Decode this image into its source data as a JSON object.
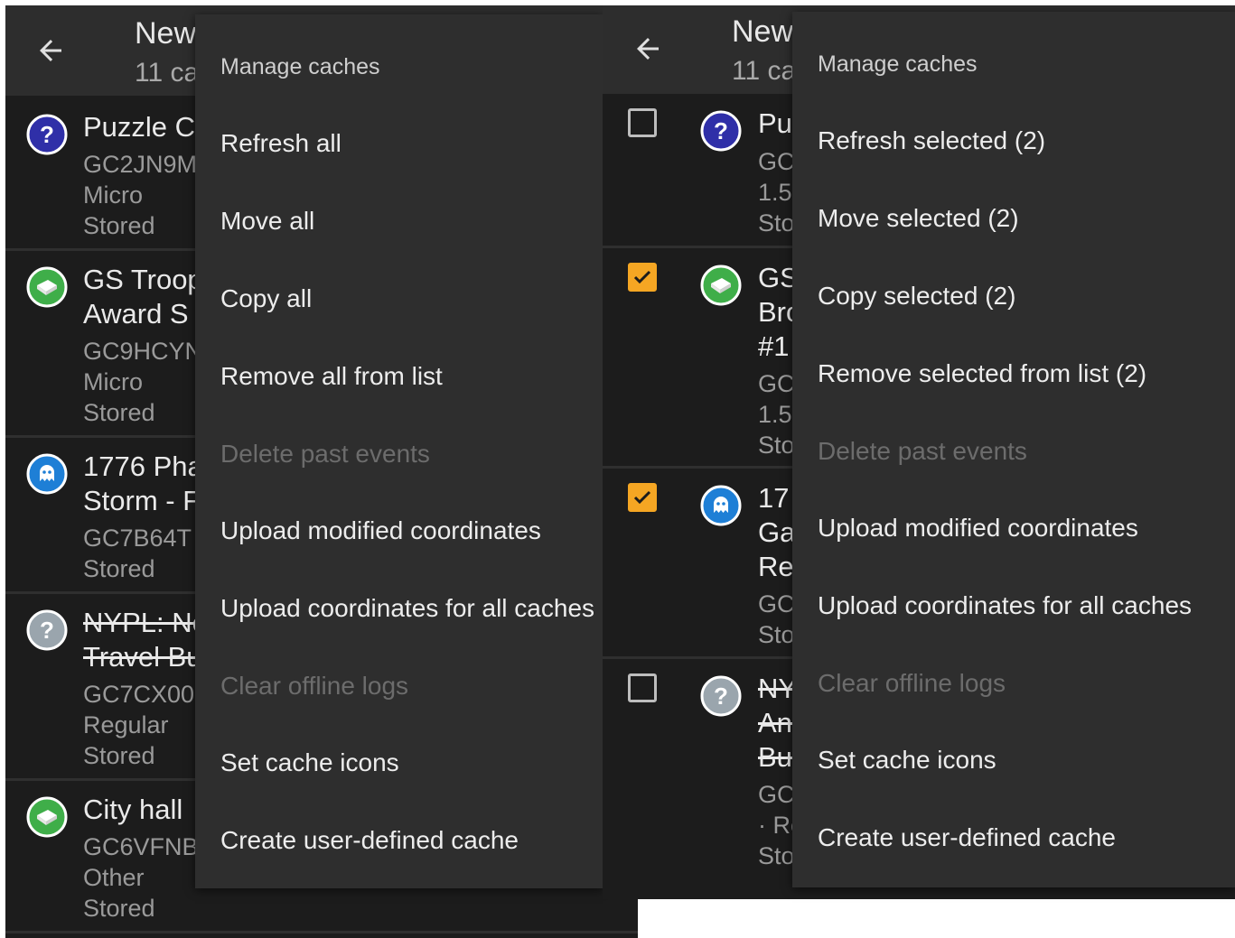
{
  "left": {
    "toolbar": {
      "title": "New",
      "subtitle": "11 ca"
    },
    "rows": [
      {
        "name1": "Puzzle C",
        "code": "GC2JN9M",
        "size": "Micro",
        "status": "Stored"
      },
      {
        "name1": "GS Troop",
        "name2": "Award S",
        "code": "GC9HCYN",
        "size": "Micro",
        "status": "Stored"
      },
      {
        "name1": "1776 Pha",
        "name2": "Storm - F",
        "code": "GC7B64T",
        "status": "Stored"
      },
      {
        "name1": "NYPL: Ne",
        "name2": "Travel Bu",
        "code": "GC7CX00",
        "size": "Regular",
        "status": "Stored"
      },
      {
        "name1": "City hall",
        "code": "GC6VFNB",
        "size": "Other",
        "status": "Stored"
      }
    ],
    "menu": {
      "header": "Manage caches",
      "items": [
        {
          "label": "Refresh all",
          "enabled": true
        },
        {
          "label": "Move all",
          "enabled": true
        },
        {
          "label": "Copy all",
          "enabled": true
        },
        {
          "label": "Remove all from list",
          "enabled": true
        },
        {
          "label": "Delete past events",
          "enabled": false
        },
        {
          "label": "Upload modified coordinates",
          "enabled": true
        },
        {
          "label": "Upload coordinates for all caches",
          "enabled": true
        },
        {
          "label": "Clear offline logs",
          "enabled": false
        },
        {
          "label": "Set cache icons",
          "enabled": true
        },
        {
          "label": "Create user-defined cache",
          "enabled": true
        }
      ]
    }
  },
  "right": {
    "toolbar": {
      "title": "New",
      "subtitle": "11 ca"
    },
    "rows": [
      {
        "checked": false,
        "lines": [
          "Pu",
          "GC",
          "1.5",
          "Sto"
        ]
      },
      {
        "checked": true,
        "lines": [
          "GS",
          "Bro",
          "#1",
          "GC",
          "1.5",
          "Sto"
        ]
      },
      {
        "checked": true,
        "lines": [
          "17",
          "Ga",
          "Re",
          "GC",
          "Sto"
        ]
      },
      {
        "checked": false,
        "lines": [
          "NY",
          "An",
          "Bu",
          "GC",
          "· Re",
          "Sto"
        ]
      }
    ],
    "menu": {
      "header": "Manage caches",
      "items": [
        {
          "label": "Refresh selected (2)",
          "enabled": true
        },
        {
          "label": "Move selected (2)",
          "enabled": true
        },
        {
          "label": "Copy selected (2)",
          "enabled": true
        },
        {
          "label": "Remove selected from list (2)",
          "enabled": true
        },
        {
          "label": "Delete past events",
          "enabled": false
        },
        {
          "label": "Upload modified coordinates",
          "enabled": true
        },
        {
          "label": "Upload coordinates for all caches",
          "enabled": true
        },
        {
          "label": "Clear offline logs",
          "enabled": false
        },
        {
          "label": "Set cache icons",
          "enabled": true
        },
        {
          "label": "Create user-defined cache",
          "enabled": true
        }
      ]
    }
  },
  "colors": {
    "mystery": "#2f2fa8",
    "traditional": "#3fae49",
    "event": "#1e7fd6",
    "unknown_archived": "#9aa5ad",
    "checkbox": "#f5a623"
  },
  "icons": [
    "back-arrow-icon",
    "mystery-cache-icon",
    "traditional-cache-icon",
    "event-cache-icon",
    "checkbox-icon"
  ]
}
